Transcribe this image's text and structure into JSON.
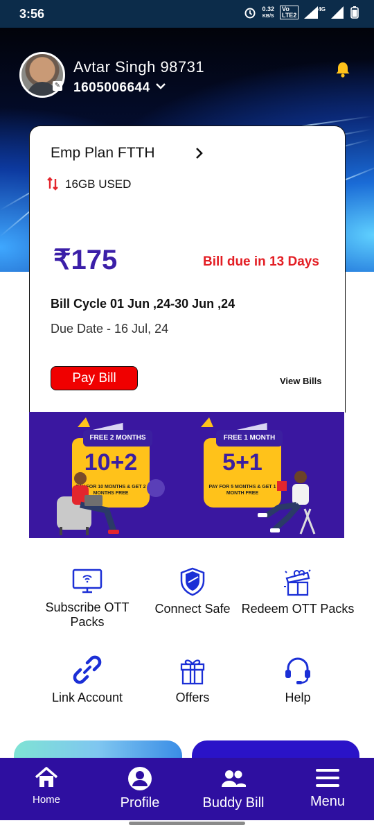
{
  "status_bar": {
    "time": "3:56",
    "speed_value": "0.32",
    "speed_unit": "KB/S",
    "volte_top": "Vo",
    "volte_bottom": "LTE2",
    "network": "4G"
  },
  "header": {
    "name": "Avtar Singh 98731",
    "number": "1605006644"
  },
  "plan_card": {
    "title": "Emp Plan FTTH",
    "usage": "16GB USED",
    "currency": "₹",
    "amount": "175",
    "due_in": "Bill due in 13 Days",
    "bill_cycle": "Bill Cycle 01 Jun ,24-30 Jun ,24",
    "due_date": "Due Date - 16 Jul, 24",
    "pay_label": "Pay Bill",
    "view_bills_label": "View Bills"
  },
  "banner": {
    "offer1": {
      "ribbon": "FREE 2 MONTHS",
      "headline": "10+2",
      "fine_print": "PAY FOR 10 MONTHS & GET 2 MONTHS FREE"
    },
    "offer2": {
      "ribbon": "FREE 1 MONTH",
      "headline": "5+1",
      "fine_print": "PAY FOR 5 MONTHS & GET 1 MONTH FREE"
    }
  },
  "quick_actions": [
    {
      "label": "Subscribe OTT Packs",
      "icon": "tv-icon"
    },
    {
      "label": "Connect Safe",
      "icon": "shield-icon"
    },
    {
      "label": "Redeem OTT Packs",
      "icon": "gift-box-icon"
    },
    {
      "label": "Link Account",
      "icon": "link-icon"
    },
    {
      "label": "Offers",
      "icon": "gift-icon"
    },
    {
      "label": "Help",
      "icon": "headset-icon"
    }
  ],
  "bottom_nav": [
    {
      "label": "Home",
      "icon": "home-icon"
    },
    {
      "label": "Profile",
      "icon": "profile-icon"
    },
    {
      "label": "Buddy Bill",
      "icon": "group-icon"
    },
    {
      "label": "Menu",
      "icon": "menu-icon"
    }
  ],
  "colors": {
    "brand_purple": "#2e0fa0",
    "amount_purple": "#3b1fa8",
    "alert_red": "#e31e24",
    "icon_blue": "#1b2fd6",
    "bell_yellow": "#ffc21a"
  }
}
